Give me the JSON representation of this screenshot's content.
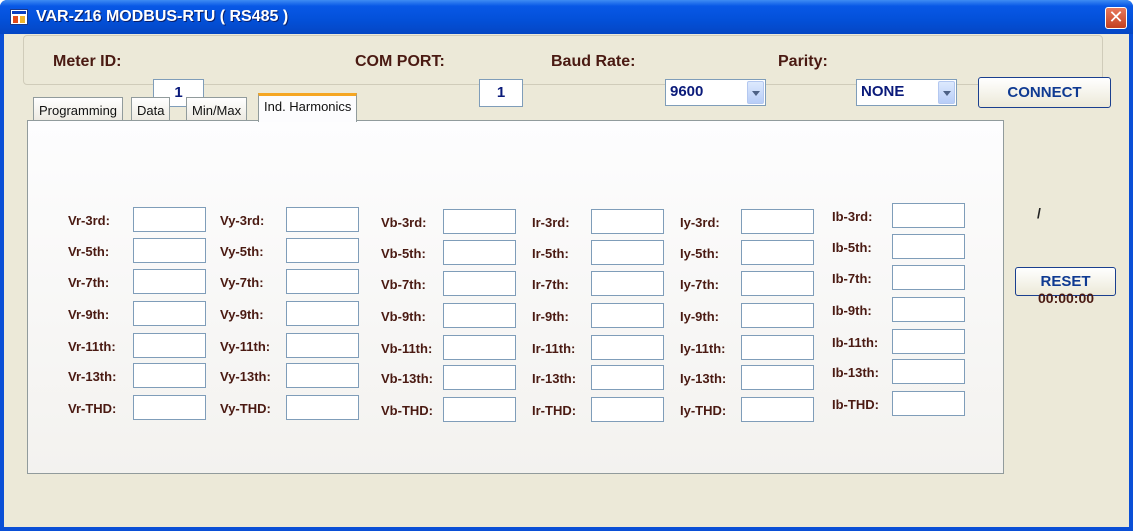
{
  "window": {
    "title": "VAR-Z16 MODBUS-RTU ( RS485 )",
    "close_glyph": "✕"
  },
  "connection": {
    "meter_id_label": "Meter ID:",
    "meter_id_value": "1",
    "com_port_label": "COM PORT:",
    "com_port_value": "1",
    "baud_rate_label": "Baud Rate:",
    "baud_rate_value": "9600",
    "parity_label": "Parity:",
    "parity_value": "NONE",
    "connect_label": "CONNECT"
  },
  "tabs": [
    {
      "label": "Programming",
      "active": false
    },
    {
      "label": "Data",
      "active": false
    },
    {
      "label": "Min/Max",
      "active": false
    },
    {
      "label": "Ind. Harmonics",
      "active": true
    }
  ],
  "harmonics": {
    "columns": [
      {
        "prefix": "Vr",
        "labels": [
          "Vr-3rd:",
          "Vr-5th:",
          "Vr-7th:",
          "Vr-9th:",
          "Vr-11th:",
          "Vr-13th:",
          "Vr-THD:"
        ],
        "values": [
          "",
          "",
          "",
          "",
          "",
          "",
          ""
        ]
      },
      {
        "prefix": "Vy",
        "labels": [
          "Vy-3rd:",
          "Vy-5th:",
          "Vy-7th:",
          "Vy-9th:",
          "Vy-11th:",
          "Vy-13th:",
          "Vy-THD:"
        ],
        "values": [
          "",
          "",
          "",
          "",
          "",
          "",
          ""
        ]
      },
      {
        "prefix": "Vb",
        "labels": [
          "Vb-3rd:",
          "Vb-5th:",
          "Vb-7th:",
          "Vb-9th:",
          "Vb-11th:",
          "Vb-13th:",
          "Vb-THD:"
        ],
        "values": [
          "",
          "",
          "",
          "",
          "",
          "",
          ""
        ]
      },
      {
        "prefix": "Ir",
        "labels": [
          "Ir-3rd:",
          "Ir-5th:",
          "Ir-7th:",
          "Ir-9th:",
          "Ir-11th:",
          "Ir-13th:",
          "Ir-THD:"
        ],
        "values": [
          "",
          "",
          "",
          "",
          "",
          "",
          ""
        ]
      },
      {
        "prefix": "Iy",
        "labels": [
          "Iy-3rd:",
          "Iy-5th:",
          "Iy-7th:",
          "Iy-9th:",
          "Iy-11th:",
          "Iy-13th:",
          "Iy-THD:"
        ],
        "values": [
          "",
          "",
          "",
          "",
          "",
          "",
          ""
        ]
      },
      {
        "prefix": "Ib",
        "labels": [
          "Ib-3rd:",
          "Ib-5th:",
          "Ib-7th:",
          "Ib-9th:",
          "Ib-11th:",
          "Ib-13th:",
          "Ib-THD:"
        ],
        "values": [
          "",
          "",
          "",
          "",
          "",
          "",
          ""
        ]
      }
    ]
  },
  "side": {
    "status_mark": "/",
    "reset_label": "RESET",
    "timer": "00:00:00"
  },
  "colors": {
    "label_text": "#4a1a12",
    "value_text": "#0a1a7a",
    "button_text": "#0f3a92",
    "active_tab_accent": "#f5a623"
  }
}
